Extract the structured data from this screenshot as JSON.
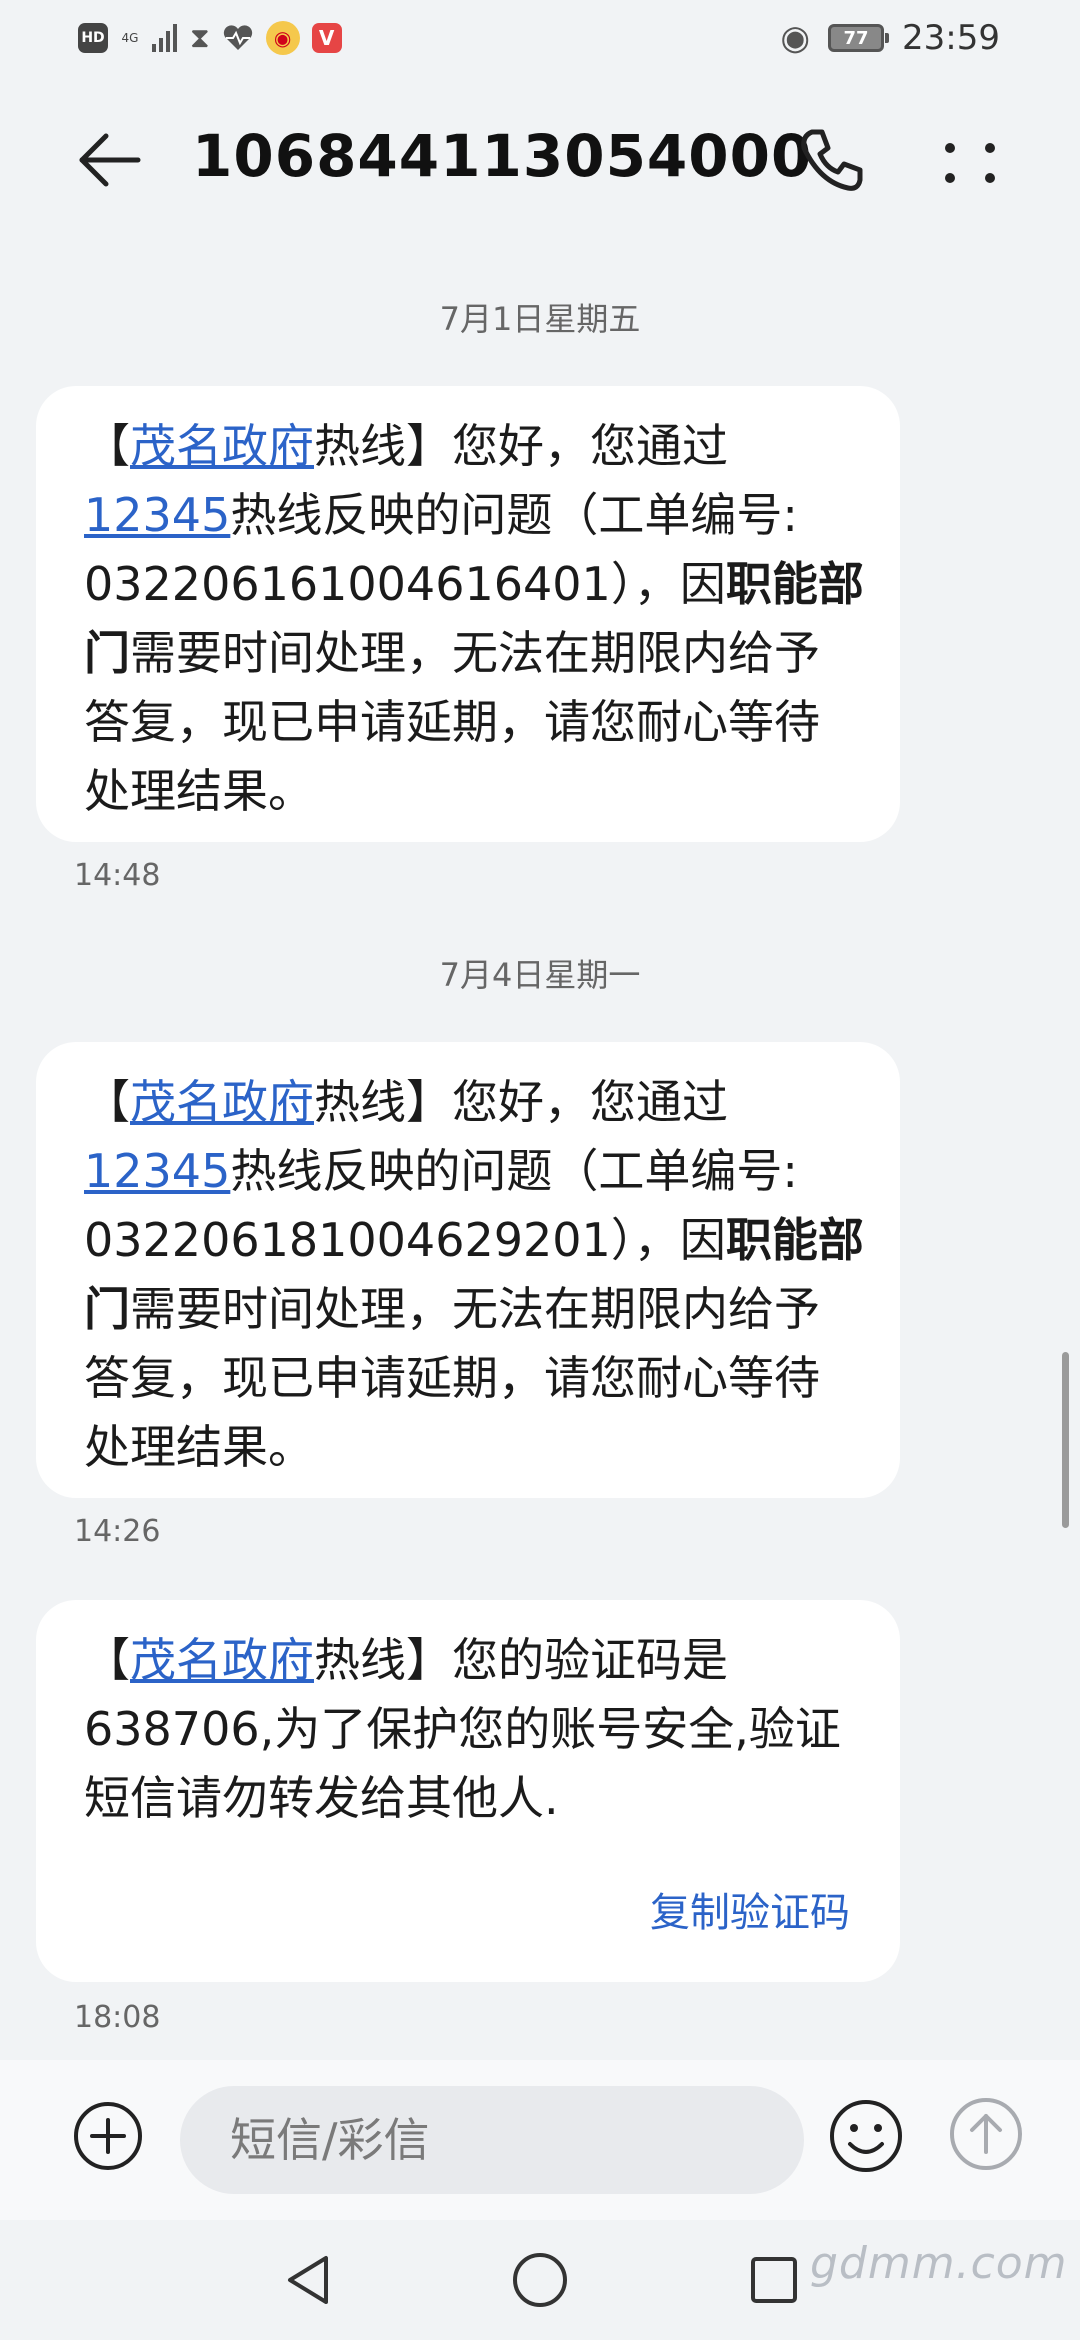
{
  "status_bar": {
    "hd": "HD",
    "signal": "4G",
    "battery": "77",
    "time": "23:59"
  },
  "header": {
    "title": "106844113054000",
    "back_icon": "arrow-left-icon",
    "call_icon": "phone-icon",
    "more_icon": "more-vertical-icon"
  },
  "messages": [
    {
      "date": "7月1日星期五",
      "time": "14:48",
      "link_text": "茂名政府",
      "link_number": "12345",
      "ticket": "032206161004616401"
    },
    {
      "date": "7月4日星期一",
      "time": "14:26",
      "link_text": "茂名政府",
      "link_number": "12345",
      "ticket": "032206181004629201"
    },
    {
      "time": "18:08",
      "link_text": "茂名政府",
      "code": "638706",
      "copy_label": "复制验证码"
    }
  ],
  "texts": {
    "bracket_open": "【",
    "hotline_suffix": "热线】您好，您通过",
    "issue_prefix": "热线反映的问题（工单编号:",
    "issue_close": "），因",
    "dept_bold": "职能部门",
    "extension_text": "需要时间处理，无法在期限内给予答复，现已申请延期，请您耐心等待处理结果。",
    "code_prefix": "热线】您的验证码是",
    "code_suffix": ",为了保护您的账号安全,验证短信请勿转发给其他人."
  },
  "composer": {
    "placeholder": "短信/彩信"
  },
  "watermark": "gdmm.com",
  "colors": {
    "background": "#f1f3f5",
    "bubble": "#ffffff",
    "link": "#2b63c8"
  }
}
